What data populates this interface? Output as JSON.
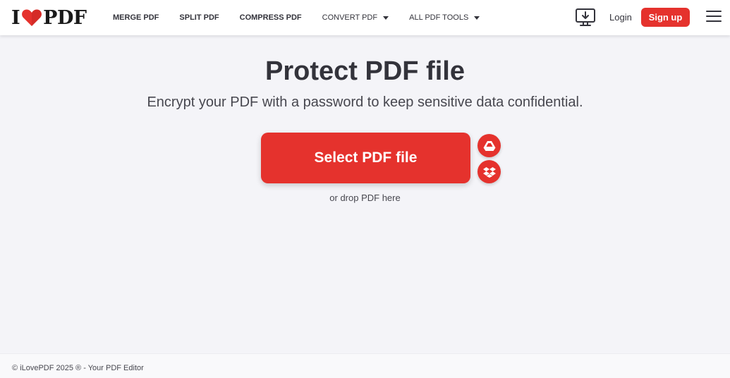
{
  "brand": {
    "logo_left": "I",
    "logo_right": "PDF",
    "accent_color": "#e5322d"
  },
  "nav": {
    "items": [
      {
        "label": "MERGE PDF",
        "has_dropdown": false
      },
      {
        "label": "SPLIT PDF",
        "has_dropdown": false
      },
      {
        "label": "COMPRESS PDF",
        "has_dropdown": false
      },
      {
        "label": "CONVERT PDF",
        "has_dropdown": true
      },
      {
        "label": "ALL PDF TOOLS",
        "has_dropdown": true
      }
    ]
  },
  "header_actions": {
    "desktop_icon": "desktop-download-icon",
    "login_label": "Login",
    "signup_label": "Sign up",
    "menu_icon": "hamburger-menu-icon"
  },
  "main": {
    "title": "Protect PDF file",
    "subtitle": "Encrypt your PDF with a password to keep sensitive data confidential.",
    "select_button_label": "Select PDF file",
    "cloud_buttons": [
      "google-drive-icon",
      "dropbox-icon"
    ],
    "drop_hint": "or drop PDF here"
  },
  "footer": {
    "text": "© iLovePDF 2025 ® - Your PDF Editor"
  }
}
